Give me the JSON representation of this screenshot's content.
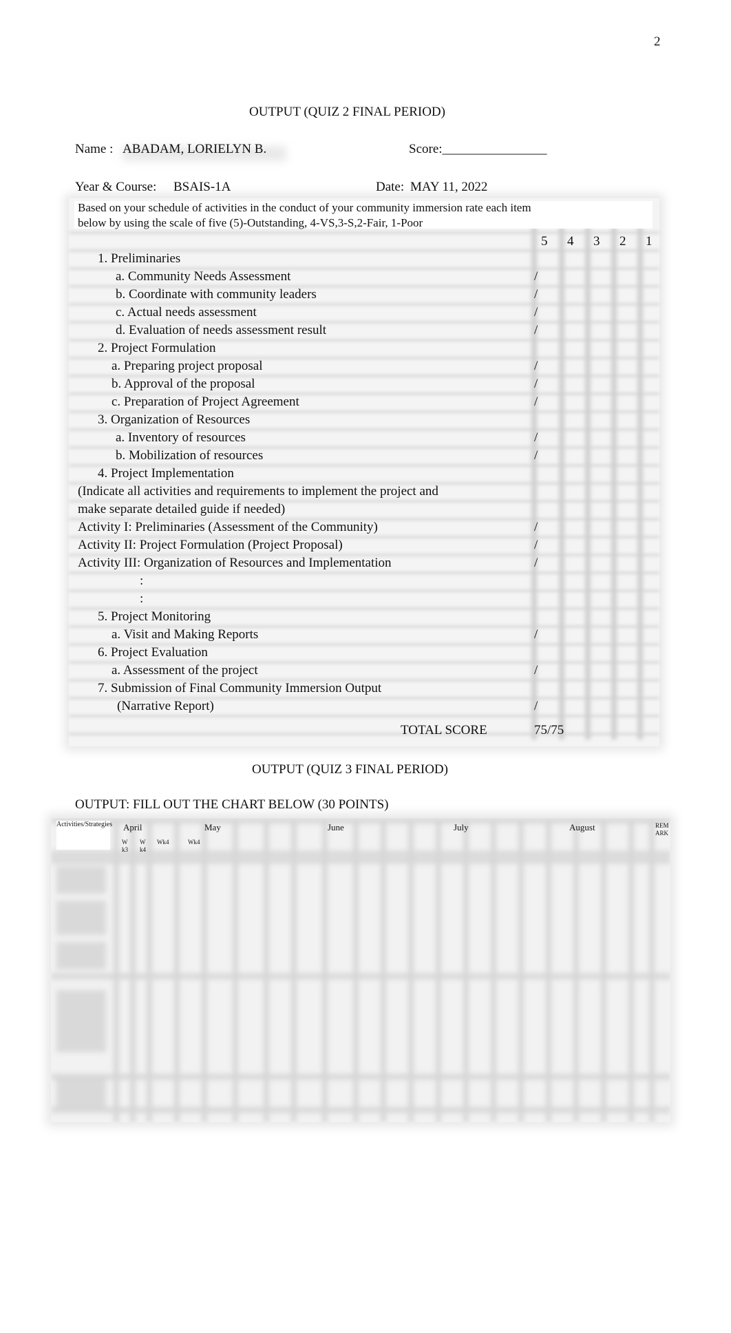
{
  "page_number": "2",
  "quiz2": {
    "title": "OUTPUT (QUIZ 2 FINAL PERIOD)",
    "name_label": "Name :",
    "name_value": "ABADAM, LORIELYN B.",
    "score_label": "Score:________________",
    "year_course_label": "Year & Course:",
    "year_course_value": "BSAIS-1A",
    "date_label": "Date:",
    "date_value": "MAY 11, 2022",
    "instructions_line1": "Based on your schedule of activities in the conduct of your community immersion rate each item",
    "instructions_line2": "below by using the scale of five (5)-Outstanding, 4-VS,3-S,2-Fair, 1-Poor",
    "scale_headers": [
      "5",
      "4",
      "3",
      "2",
      "1"
    ],
    "items": [
      {
        "text": "1. Preliminaries",
        "mark": ""
      },
      {
        "text": "a. Community Needs Assessment",
        "mark": "/"
      },
      {
        "text": "b. Coordinate with community leaders",
        "mark": "/"
      },
      {
        "text": "c. Actual needs assessment",
        "mark": "/"
      },
      {
        "text": "d. Evaluation of needs assessment result",
        "mark": "/"
      },
      {
        "text": "2. Project Formulation",
        "mark": ""
      },
      {
        "text": "a. Preparing project proposal",
        "mark": "/"
      },
      {
        "text": "b. Approval of the proposal",
        "mark": "/"
      },
      {
        "text": "c. Preparation of Project Agreement",
        "mark": "/"
      },
      {
        "text": "3. Organization of Resources",
        "mark": ""
      },
      {
        "text": "a. Inventory of resources",
        "mark": "/"
      },
      {
        "text": "b. Mobilization of resources",
        "mark": "/"
      },
      {
        "text": "4. Project Implementation",
        "mark": ""
      },
      {
        "text": "(Indicate all activities and requirements to implement the project and",
        "mark": ""
      },
      {
        "text": "make separate detailed guide if needed)",
        "mark": ""
      },
      {
        "text": "Activity I: Preliminaries (Assessment of the Community)",
        "mark": "/"
      },
      {
        "text": "Activity II: Project Formulation (Project Proposal)",
        "mark": "/"
      },
      {
        "text": "Activity III: Organization of Resources and Implementation",
        "mark": "/"
      },
      {
        "text": ":",
        "mark": ""
      },
      {
        "text": ":",
        "mark": ""
      },
      {
        "text": "5. Project Monitoring",
        "mark": ""
      },
      {
        "text": "a. Visit and Making Reports",
        "mark": "/"
      },
      {
        "text": "6. Project Evaluation",
        "mark": ""
      },
      {
        "text": "a. Assessment of the project",
        "mark": "/"
      },
      {
        "text": "7. Submission of Final Community Immersion Output",
        "mark": ""
      },
      {
        "text": "(Narrative Report)",
        "mark": "/"
      }
    ],
    "total_label": "TOTAL SCORE",
    "total_value": "75/75"
  },
  "quiz3": {
    "title": "OUTPUT (QUIZ 3 FINAL PERIOD)",
    "instruction": "OUTPUT:  FILL OUT THE CHART BELOW (30 POINTS)",
    "chart": {
      "activities_header": "Activities/Strategies",
      "months": [
        "April",
        "May",
        "June",
        "July",
        "August"
      ],
      "remark_header": "REMARK",
      "week_labels": [
        "Wk3",
        "Wk4",
        "Wk4",
        "Wk4"
      ]
    }
  }
}
